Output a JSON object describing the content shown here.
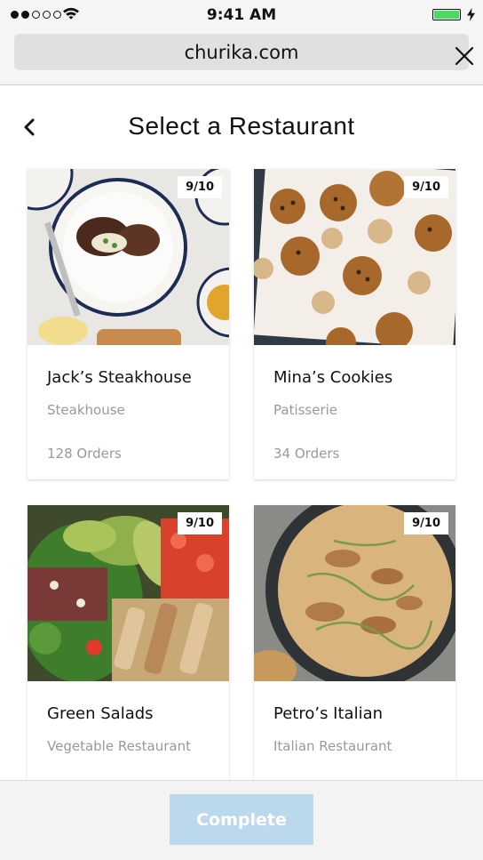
{
  "status_bar": {
    "time": "9:41 AM",
    "signal_dots_filled": 2,
    "signal_dots_total": 5,
    "battery_level": 1.0,
    "battery_color": "#4cd964"
  },
  "browser": {
    "url": "churika.com",
    "close_icon": "close-icon"
  },
  "header": {
    "back_icon": "chevron-left-icon",
    "title": "Select a Restaurant"
  },
  "restaurants": [
    {
      "name": "Jack’s Steakhouse",
      "category": "Steakhouse",
      "orders": "128 Orders",
      "rating": "9/10",
      "photo": "steak-dish-photo"
    },
    {
      "name": "Mina’s Cookies",
      "category": "Patisserie",
      "orders": "34 Orders",
      "rating": "9/10",
      "photo": "cookies-photo"
    },
    {
      "name": "Green Salads",
      "category": "Vegetable Restaurant",
      "orders": "",
      "rating": "9/10",
      "photo": "salad-photo"
    },
    {
      "name": "Petro’s Italian",
      "category": "Italian Restaurant",
      "orders": "",
      "rating": "9/10",
      "photo": "pasta-pan-photo"
    }
  ],
  "footer": {
    "complete_label": "Complete",
    "complete_color": "#bcd8ec"
  }
}
